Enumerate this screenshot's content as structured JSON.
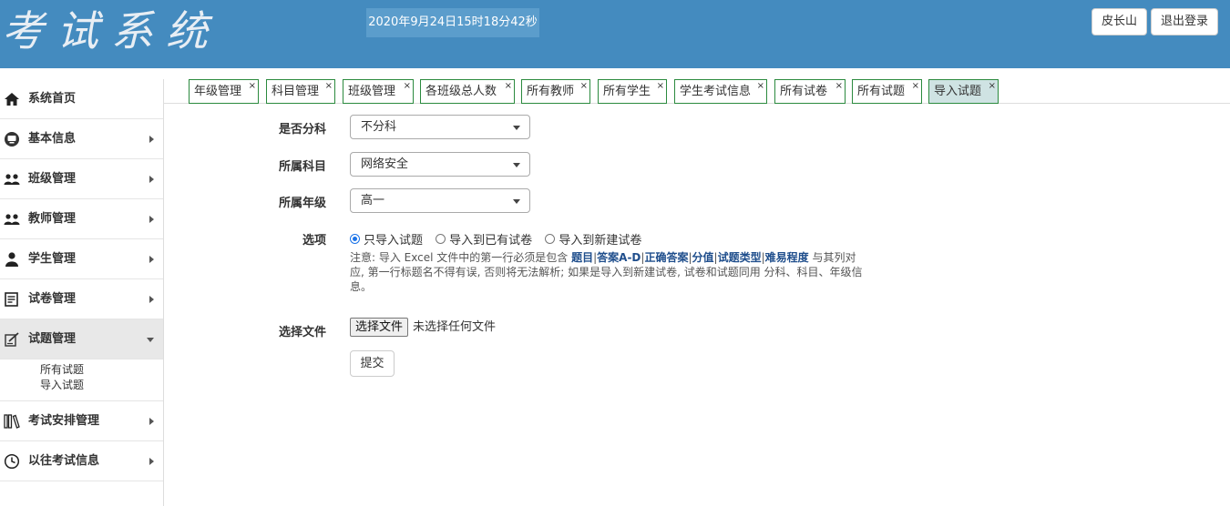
{
  "header": {
    "logo_text": "考试系统",
    "datetime": "2020年9月24日15时18分42秒",
    "user_name": "皮长山",
    "logout_label": "退出登录"
  },
  "sidebar": {
    "items": [
      {
        "label": "系统首页",
        "icon": "home-icon"
      },
      {
        "label": "基本信息",
        "icon": "monitor-icon"
      },
      {
        "label": "班级管理",
        "icon": "users-icon"
      },
      {
        "label": "教师管理",
        "icon": "teacher-icon"
      },
      {
        "label": "学生管理",
        "icon": "user-icon"
      },
      {
        "label": "试卷管理",
        "icon": "document-icon"
      },
      {
        "label": "试题管理",
        "icon": "edit-icon"
      },
      {
        "label": "考试安排管理",
        "icon": "books-icon"
      },
      {
        "label": "以往考试信息",
        "icon": "clock-icon"
      }
    ],
    "sub_items": [
      "所有试题",
      "导入试题"
    ]
  },
  "tabs": [
    {
      "label": "年级管理"
    },
    {
      "label": "科目管理"
    },
    {
      "label": "班级管理"
    },
    {
      "label": "各班级总人数"
    },
    {
      "label": "所有教师"
    },
    {
      "label": "所有学生"
    },
    {
      "label": "学生考试信息"
    },
    {
      "label": "所有试卷"
    },
    {
      "label": "所有试题"
    },
    {
      "label": "导入试题"
    }
  ],
  "tab_close_glyph": "×",
  "form": {
    "split_label": "是否分科",
    "split_value": "不分科",
    "subject_label": "所属科目",
    "subject_value": "网络安全",
    "grade_label": "所属年级",
    "grade_value": "高一",
    "options_label": "选项",
    "radio_options": [
      "只导入试题",
      "导入到已有试卷",
      "导入到新建试卷"
    ],
    "selected_option": 0,
    "note": {
      "prefix": "注意: 导入 Excel 文件中的第一行必须是包含 ",
      "fields": [
        "题目",
        "答案A-D",
        "正确答案",
        "分值",
        "试题类型",
        "难易程度"
      ],
      "separator": "|",
      "suffix": " 与其列对应, 第一行标题名不得有误, 否则将无法解析; 如果是导入到新建试卷, 试卷和试题同用 分科、科目、年级信息。"
    },
    "file_label": "选择文件",
    "file_button": "选择文件",
    "file_status": "未选择任何文件",
    "submit_label": "提交"
  },
  "colors": {
    "header_bg": "#448bbf",
    "datetime_bg": "#5b9dcc",
    "tab_border": "#2b8a3e",
    "active_tab_bg": "#cfe3e3",
    "active_side_bg": "#e8e8e8",
    "note_highlight": "#1f4e8c"
  }
}
